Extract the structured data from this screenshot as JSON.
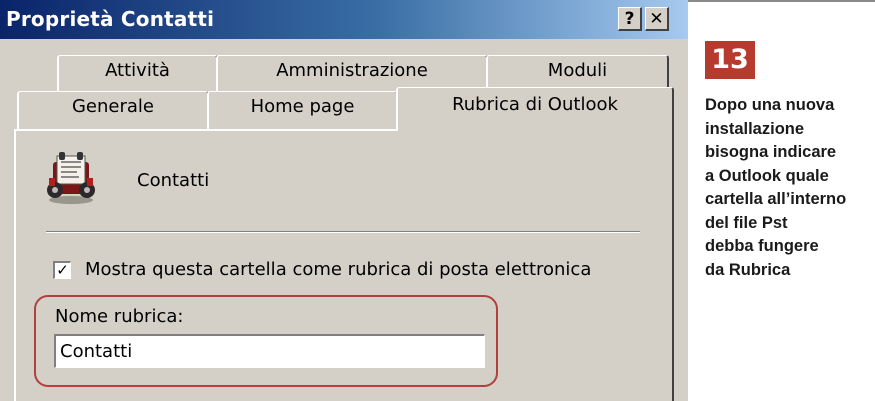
{
  "window": {
    "title": "Proprietà Contatti",
    "help_label": "?",
    "close_label": "✕"
  },
  "tabs": {
    "row1": [
      "Attività",
      "Amministrazione",
      "Moduli"
    ],
    "row2": [
      "Generale",
      "Home page",
      "Rubrica di Outlook"
    ],
    "active": "Rubrica di Outlook"
  },
  "panel": {
    "folder_icon": "address-book-icon",
    "folder_name": "Contatti",
    "checkbox_checked": true,
    "checkbox_mark": "✓",
    "checkbox_label": "Mostra questa cartella come rubrica di posta elettronica",
    "field_label": "Nome rubrica:",
    "field_value": "Contatti"
  },
  "caption": {
    "number": "13",
    "lines": [
      "Dopo una nuova",
      "installazione",
      "bisogna indicare",
      "a Outlook quale",
      "cartella all’interno",
      "del file Pst",
      "debba fungere",
      "da Rubrica"
    ]
  },
  "colors": {
    "accent": "#b73a2e",
    "highlight": "#b0413e",
    "titlebar_start": "#0a246a",
    "titlebar_end": "#a6caf0",
    "dialog_bg": "#d4d0c8"
  }
}
